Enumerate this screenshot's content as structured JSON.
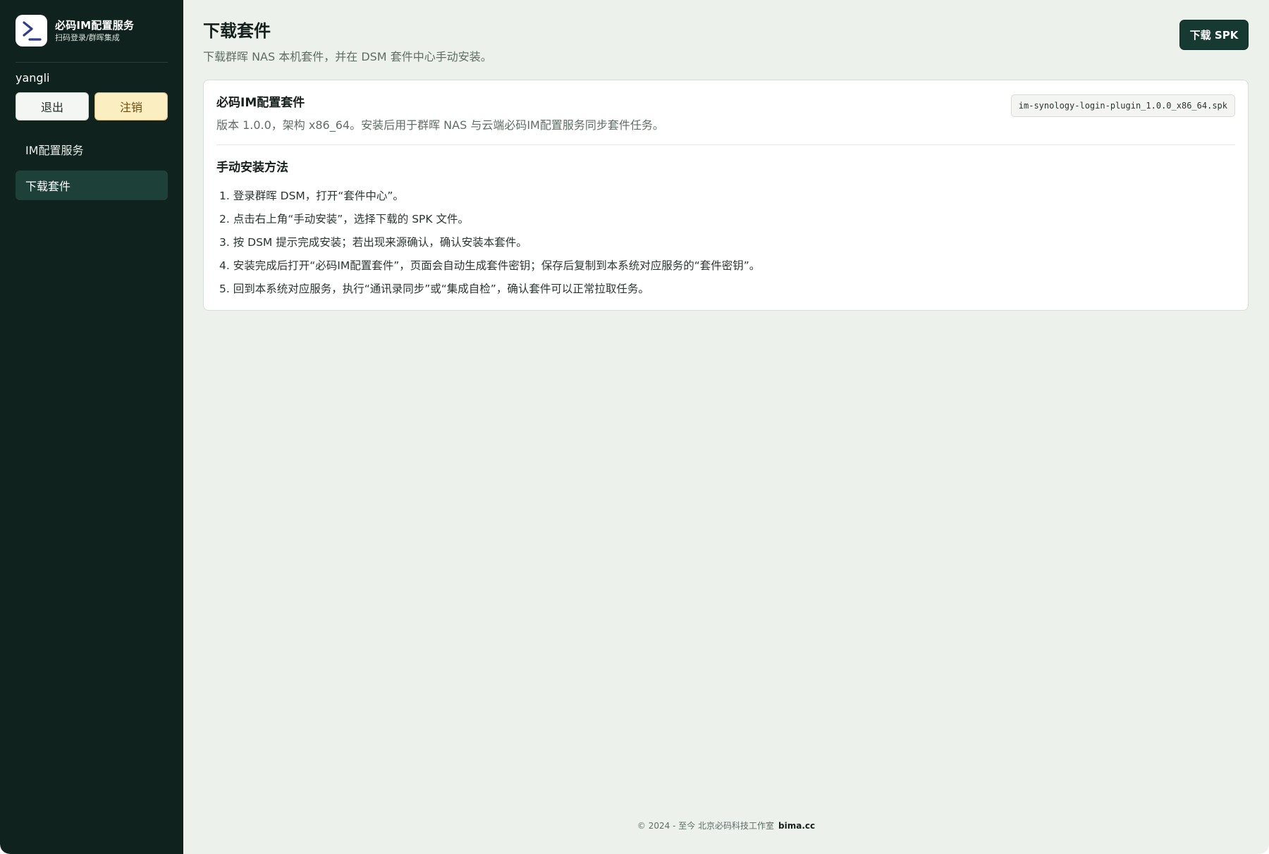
{
  "sidebar": {
    "brand_title": "必码IM配置服务",
    "brand_subtitle": "扫码登录/群晖集成",
    "logo_icon": "terminal-prompt-icon",
    "username": "yangli",
    "logout_label": "退出",
    "deregister_label": "注销",
    "nav": [
      {
        "label": "IM配置服务",
        "active": false
      },
      {
        "label": "下载套件",
        "active": true
      }
    ]
  },
  "main": {
    "title": "下载套件",
    "subtitle": "下载群晖 NAS 本机套件，并在 DSM 套件中心手动安装。",
    "download_button": "下载 SPK",
    "card": {
      "title": "必码IM配置套件",
      "description": "版本 1.0.0，架构 x86_64。安装后用于群晖 NAS 与云端必码IM配置服务同步套件任务。",
      "filename": "im-synology-login-plugin_1.0.0_x86_64.spk",
      "section_title": "手动安装方法",
      "steps": [
        "1. 登录群晖 DSM，打开“套件中心”。",
        "2. 点击右上角“手动安装”，选择下载的 SPK 文件。",
        "3. 按 DSM 提示完成安装；若出现来源确认，确认安装本套件。",
        "4. 安装完成后打开“必码IM配置套件”，页面会自动生成套件密钥；保存后复制到本系统对应服务的“套件密钥”。",
        "5. 回到本系统对应服务，执行“通讯录同步”或“集成自检”，确认套件可以正常拉取任务。"
      ]
    }
  },
  "footer": {
    "text": "© 2024 - 至今 北京必码科技工作室",
    "link": "bima.cc"
  },
  "colors": {
    "sidebar_bg": "#10221d",
    "active_nav": "#1d4138",
    "primary_button": "#163a31",
    "page_bg": "#ecf1ec",
    "logo_accent": "#2f3d8f"
  }
}
